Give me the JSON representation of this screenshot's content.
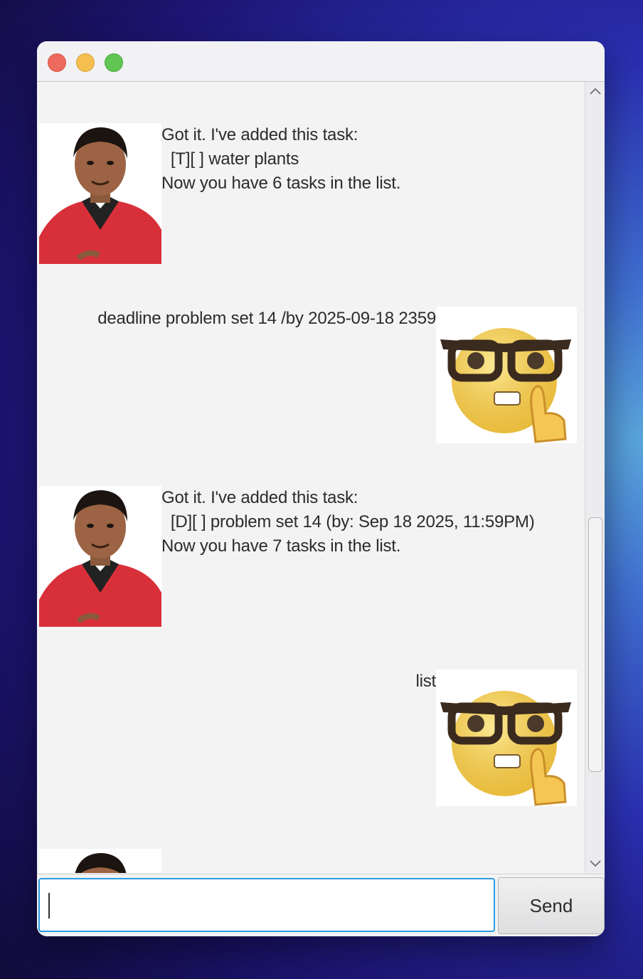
{
  "window": {
    "controls": {
      "close": "close",
      "minimize": "minimize",
      "maximize": "zoom"
    }
  },
  "messages": [
    {
      "sender": "bot",
      "lines": [
        "Got it. I've added this task:",
        "  [T][ ] water plants",
        "Now you have 6 tasks in the list."
      ]
    },
    {
      "sender": "user",
      "lines": [
        "deadline problem set 14 /by 2025-09-18 2359"
      ]
    },
    {
      "sender": "bot",
      "lines": [
        "Got it. I've added this task:",
        "  [D][ ] problem set 14 (by: Sep 18 2025, 11:59PM)",
        "Now you have 7 tasks in the list."
      ]
    },
    {
      "sender": "user",
      "lines": [
        "list"
      ]
    }
  ],
  "input": {
    "value": "",
    "placeholder": ""
  },
  "send_button": {
    "label": "Send"
  },
  "scrollbar": {
    "position_fraction": 0.55,
    "visible_fraction": 0.32
  },
  "colors": {
    "accent": "#2b9be0",
    "close": "#ed6a5e",
    "minimize": "#f4bf4f",
    "zoom": "#61c554"
  }
}
